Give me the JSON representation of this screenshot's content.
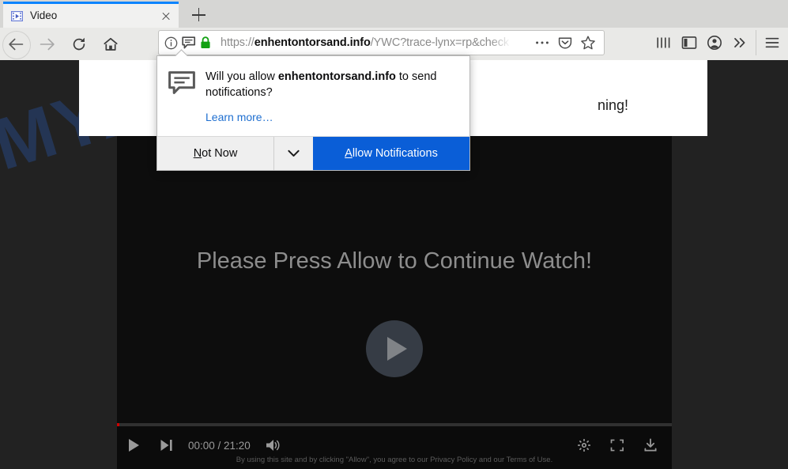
{
  "browser": {
    "tab": {
      "title": "Video",
      "favicon_icon": "video-film-icon",
      "close_icon": "close-icon"
    },
    "new_tab_label": "+",
    "nav": {
      "back_icon": "back-arrow-icon",
      "forward_icon": "forward-arrow-icon",
      "reload_icon": "reload-icon",
      "home_icon": "home-icon"
    },
    "urlbar": {
      "info_icon": "site-information-icon",
      "notification_icon": "notification-permission-icon",
      "lock_icon": "padlock-secure-icon",
      "url_scheme": "https://",
      "url_host": "enhentontorsand.info",
      "url_path": "/YWC?trace-lynx=rp&check",
      "page_actions_icon": "ellipsis-icon",
      "pocket_icon": "pocket-icon",
      "bookmark_icon": "star-bookmark-icon"
    },
    "toolbar_right": {
      "library_icon": "library-icon",
      "sidebar_icon": "sidebar-icon",
      "account_icon": "account-avatar-icon",
      "overflow_icon": "double-chevron-icon",
      "menu_icon": "hamburger-menu-icon"
    }
  },
  "doorhanger": {
    "icon": "speech-bubble-notification-icon",
    "message_prefix": "Will you allow ",
    "message_host": "enhentontorsand.info",
    "message_suffix": " to send notifications?",
    "learn_more": "Learn more…",
    "not_now_label": "Not Now",
    "dropdown_icon": "chevron-down-icon",
    "allow_label": "Allow Notifications",
    "accent_color": "#0a5ed7"
  },
  "page": {
    "watermark": "MYANTISPYWARE.COM",
    "banner_text_visible": "ning!",
    "player": {
      "headline": "Please Press Allow to Continue Watch!",
      "play_overlay_icon": "play-circle-icon",
      "controls": {
        "play_icon": "play-icon",
        "next_icon": "skip-next-icon",
        "time_current": "00:00",
        "time_separator": " / ",
        "time_total": "21:20",
        "time_display": "00:00 / 21:20",
        "volume_icon": "volume-on-icon",
        "settings_icon": "gear-settings-icon",
        "fullscreen_icon": "fullscreen-icon",
        "download_icon": "download-icon",
        "progress_color": "#cc0000"
      },
      "disclaimer": "By using this site and by clicking \"Allow\", you agree to our Privacy Policy and our Terms of Use."
    }
  }
}
